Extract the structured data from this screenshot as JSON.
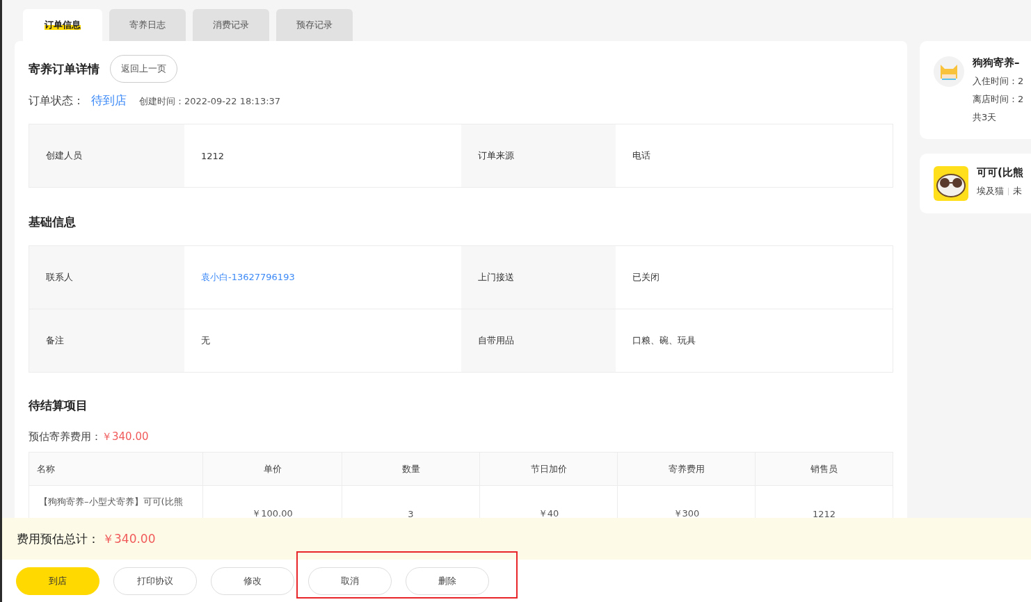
{
  "tabs": [
    {
      "label": "订单信息",
      "selected": true
    },
    {
      "label": "寄养日志",
      "selected": false
    },
    {
      "label": "消费记录",
      "selected": false
    },
    {
      "label": "预存记录",
      "selected": false
    }
  ],
  "detail": {
    "title": "寄养订单详情",
    "back_button": "返回上一页",
    "status_label": "订单状态：",
    "status": "待到店",
    "created": "创建时间：2022-09-22 18:13:37"
  },
  "order_info": [
    [
      {
        "label": "创建人员",
        "value": "1212"
      },
      {
        "label": "订单来源",
        "value": "电话"
      }
    ]
  ],
  "basic": {
    "title": "基础信息",
    "rows": [
      [
        {
          "label": "联系人",
          "value": "袁小白-13627796193",
          "kind": "link"
        },
        {
          "label": "上门接送",
          "value": "已关闭",
          "kind": "text"
        }
      ],
      [
        {
          "label": "备注",
          "value": "无",
          "kind": "text"
        },
        {
          "label": "自带用品",
          "value": "口粮、碗、玩具",
          "kind": "text"
        }
      ]
    ]
  },
  "pending": {
    "title": "待结算项目",
    "estimate_label": "预估寄养费用：",
    "estimate": "￥340.00",
    "columns": [
      "名称",
      "单价",
      "数量",
      "节日加价",
      "寄养费用",
      "销售员"
    ],
    "rows": [
      [
        "【狗狗寄养–小型犬寄养】可可(比熊",
        "￥100.00",
        "3",
        "￥40",
        "￥300",
        "1212"
      ]
    ]
  },
  "side_cards": [
    {
      "kind": "stay",
      "title": "狗狗寄养–",
      "lines": [
        "入住时间：2",
        "离店时间：2",
        "共3天"
      ]
    },
    {
      "kind": "pet",
      "title": "可可(比熊",
      "tags": [
        "埃及猫",
        "未"
      ]
    }
  ],
  "total": {
    "label": "费用预估总计：",
    "value": "￥340.00"
  },
  "actions": [
    {
      "label": "到店",
      "primary": true
    },
    {
      "label": "打印协议",
      "primary": false
    },
    {
      "label": "修改",
      "primary": false
    },
    {
      "label": "取消",
      "primary": false
    },
    {
      "label": "删除",
      "primary": false
    }
  ]
}
